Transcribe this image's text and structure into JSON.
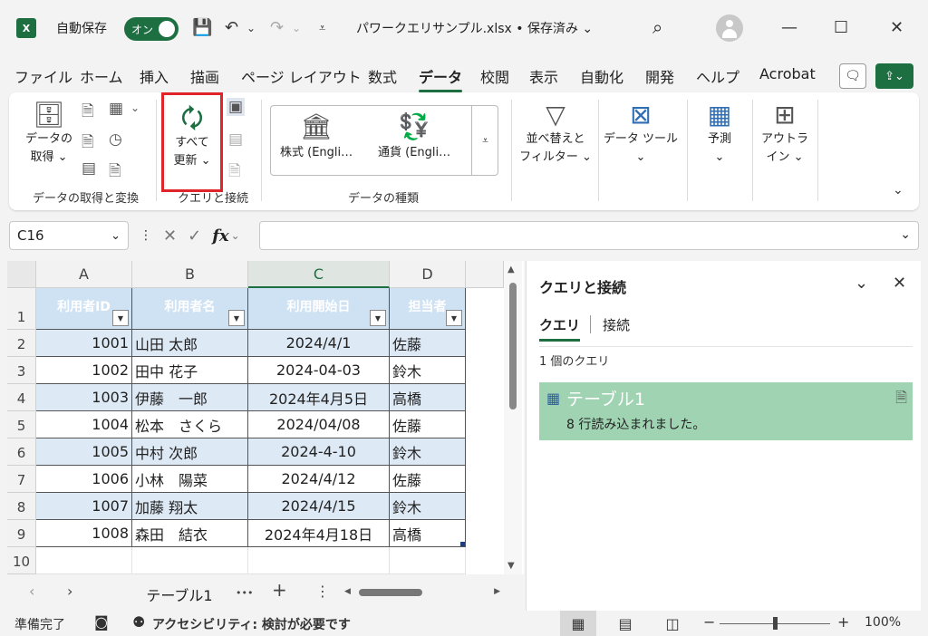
{
  "titlebar": {
    "app_icon": "X",
    "autosave_label": "自動保存",
    "autosave_state": "オン",
    "save_icon": "💾",
    "undo_icon": "↶",
    "redo_icon": "↷",
    "dropdown_glyph": "⌄",
    "customize_glyph": "⩡",
    "doc_title": "パワークエリサンプル.xlsx • 保存済み ⌄",
    "search_icon": "⌕",
    "minimize": "—",
    "maximize": "☐",
    "close": "✕"
  },
  "menu": {
    "tabs": [
      "ファイル",
      "ホーム",
      "挿入",
      "描画",
      "ページ レイアウト",
      "数式",
      "データ",
      "校閲",
      "表示",
      "自動化",
      "開発",
      "ヘルプ",
      "Acrobat"
    ],
    "active": "データ",
    "comment_icon": "🗨",
    "share_icon": "⇪⌄"
  },
  "ribbon": {
    "get_data": {
      "icon": "🗄",
      "line1": "データの",
      "line2": "取得 ⌄"
    },
    "get_group_small_icons": [
      "🗎",
      "▦",
      "🗎",
      "◷",
      "▤",
      "🗎"
    ],
    "get_group_label": "データの取得と変換",
    "refresh_all": {
      "icon": "🗘",
      "line1": "すべて",
      "line2": "更新 ⌄"
    },
    "query_group_small_icons": [
      "▣",
      "▤",
      "🗎"
    ],
    "query_group_label": "クエリと接続",
    "stocks": {
      "icon": "🏛",
      "label": "株式 (Engli…"
    },
    "currency": {
      "icon": "💱",
      "label": "通貨 (Engli…"
    },
    "datatypes_expand": "⩡",
    "datatypes_group_label": "データの種類",
    "sort_filter": {
      "icon": "▽",
      "line1": "並べ替えと",
      "line2": "フィルター ⌄"
    },
    "data_tools": {
      "icon": "⊠",
      "line1": "データ ツール",
      "line2": "⌄"
    },
    "forecast": {
      "icon": "▦",
      "line1": "予測",
      "line2": "⌄"
    },
    "outline": {
      "icon": "⊞",
      "line1": "アウトラ",
      "line2": "イン ⌄"
    },
    "collapse_icon": "⌄"
  },
  "formula_bar": {
    "cell_ref": "C16",
    "namebox_dropdown": "⌄",
    "more_icon": "⋮",
    "cancel_icon": "✕",
    "enter_icon": "✓",
    "fx_label": "fx",
    "fx_dropdown": "⌄",
    "value": "",
    "expand_icon": "⌄"
  },
  "sheet": {
    "columns": [
      "A",
      "B",
      "C",
      "D"
    ],
    "selected_column": "C",
    "row_numbers": [
      "1",
      "2",
      "3",
      "4",
      "5",
      "6",
      "7",
      "8",
      "9",
      "10"
    ],
    "filter_glyph": "▼",
    "headers": [
      "利用者ID",
      "利用者名",
      "利用開始日",
      "担当者"
    ],
    "rows": [
      [
        "1001",
        "山田 太郎",
        "2024/4/1",
        "佐藤"
      ],
      [
        "1002",
        "田中 花子",
        "2024-04-03",
        "鈴木"
      ],
      [
        "1003",
        "伊藤　一郎",
        "2024年4月5日",
        "高橋"
      ],
      [
        "1004",
        "松本　さくら",
        "2024/04/08",
        "佐藤"
      ],
      [
        "1005",
        "中村 次郎",
        "2024-4-10",
        "鈴木"
      ],
      [
        "1006",
        "小林　陽菜",
        "2024/4/12",
        "佐藤"
      ],
      [
        "1007",
        "加藤 翔太",
        "2024/4/15",
        "鈴木"
      ],
      [
        "1008",
        "森田　結衣",
        "2024年4月18日",
        "高橋"
      ]
    ],
    "scroll_up": "▲",
    "scroll_down": "▼"
  },
  "sheet_tabs": {
    "prev": "‹",
    "next": "›",
    "active_tab": "テーブル1",
    "more": "•••",
    "add": "+",
    "options": "⋮",
    "hscroll_left": "◀",
    "hscroll_right": "▶"
  },
  "query_panel": {
    "title": "クエリと接続",
    "collapse_icon": "⌄",
    "close_icon": "✕",
    "tab_queries": "クエリ",
    "tab_connections": "接続",
    "count_text": "1 個のクエリ",
    "item_icon": "▦",
    "item_name": "テーブル1",
    "item_status": "8 行読み込まれました。",
    "item_refresh_icon": "🗎"
  },
  "status_bar": {
    "ready": "準備完了",
    "macro_icon": "◙",
    "accessibility_icon": "⚉",
    "accessibility": "アクセシビリティ: 検討が必要です",
    "view_normal": "▦",
    "view_page_layout": "▤",
    "view_page_break": "◫",
    "zoom_minus": "−",
    "zoom_plus": "+",
    "zoom": "100%"
  }
}
